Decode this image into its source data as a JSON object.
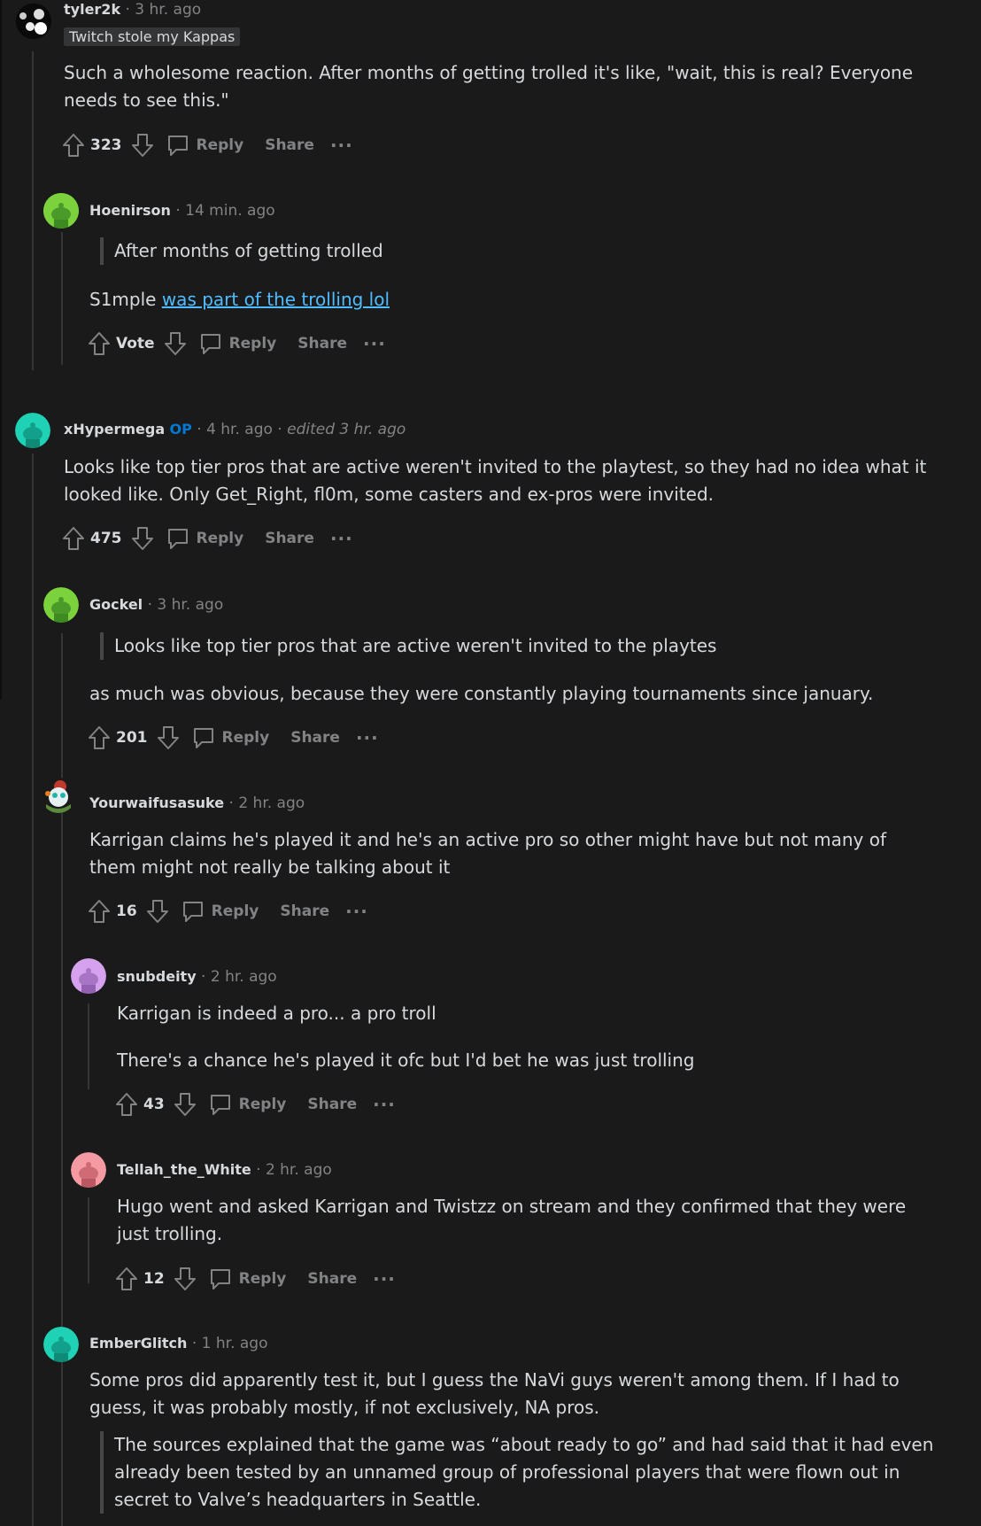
{
  "comments": [
    {
      "username": "tyler2k",
      "time": "3 hr. ago",
      "flair": "Twitch stole my Kappas",
      "body": [
        "Such a wholesome reaction. After months of getting trolled it's like, \"wait, this is real? Everyone",
        "needs to see this.\""
      ],
      "score": "323"
    },
    {
      "username": "Hoenirson",
      "time": "14 min. ago",
      "quote": "After months of getting trolled",
      "body_prefix": "S1mple ",
      "body_link": "was part of the trolling lol",
      "score": "Vote"
    },
    {
      "username": "xHypermega",
      "op": "OP",
      "time": "4 hr. ago",
      "edited": "edited 3 hr. ago",
      "body": [
        "Looks like top tier pros that are active weren't invited to the playtest, so they had no idea what it",
        "looked like. Only Get_Right, fl0m, some casters and ex-pros were invited."
      ],
      "score": "475"
    },
    {
      "username": "Gockel",
      "time": "3 hr. ago",
      "quote": "Looks like top tier pros that are active weren't invited to the playtes",
      "body": [
        "as much was obvious, because they were constantly playing tournaments since january."
      ],
      "score": "201"
    },
    {
      "username": "Yourwaifusasuke",
      "time": "2 hr. ago",
      "body": [
        "Karrigan claims he's played it and he's an active pro so other might have but not many of",
        "them might not really be talking about it"
      ],
      "score": "16"
    },
    {
      "username": "snubdeity",
      "time": "2 hr. ago",
      "body": [
        "Karrigan is indeed a pro... a pro troll"
      ],
      "body2": [
        "There's a chance he's played it ofc but I'd bet he was just trolling"
      ],
      "score": "43"
    },
    {
      "username": "Tellah_the_White",
      "time": "2 hr. ago",
      "body": [
        "Hugo went and asked Karrigan and Twistzz on stream and they confirmed that they were",
        "just trolling."
      ],
      "score": "12"
    },
    {
      "username": "EmberGlitch",
      "time": "1 hr. ago",
      "body": [
        "Some pros did apparently test it, but I guess the NaVi guys weren't among them. If I had to",
        "guess, it was probably mostly, if not exclusively, NA pros."
      ],
      "quote": [
        "The sources explained that the game was “about ready to go” and had said that it had even",
        "already been tested by an unnamed group of professional players that were flown out in",
        "secret to Valve’s headquarters in Seattle."
      ]
    }
  ],
  "labels": {
    "reply": "Reply",
    "share": "Share",
    "more": "···",
    "sep": "·"
  },
  "colors": {
    "background": "#1a1a1b",
    "text": "#d7dadc",
    "muted": "#818384",
    "link": "#4fbcff",
    "op": "#0079d3",
    "thread": "#343536"
  },
  "icons": [
    "upvote-icon",
    "downvote-icon",
    "comment-icon",
    "more-icon",
    "snoo-avatar-icon"
  ]
}
